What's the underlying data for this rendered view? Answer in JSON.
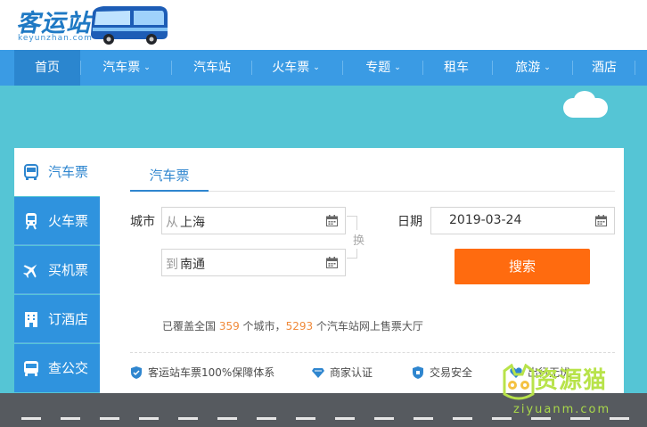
{
  "header": {
    "logo_text": "客运站",
    "logo_sub": "keyunzhan.com"
  },
  "nav": {
    "items": [
      {
        "label": "首页",
        "dropdown": false
      },
      {
        "label": "汽车票",
        "dropdown": true
      },
      {
        "label": "汽车站",
        "dropdown": false
      },
      {
        "label": "火车票",
        "dropdown": true
      },
      {
        "label": "专题",
        "dropdown": true
      },
      {
        "label": "租车",
        "dropdown": false
      },
      {
        "label": "旅游",
        "dropdown": true
      },
      {
        "label": "酒店",
        "dropdown": false
      }
    ]
  },
  "sidebar": {
    "items": [
      {
        "label": "汽车票",
        "icon": "bus-icon"
      },
      {
        "label": "火车票",
        "icon": "train-icon"
      },
      {
        "label": "买机票",
        "icon": "plane-icon"
      },
      {
        "label": "订酒店",
        "icon": "hotel-icon"
      },
      {
        "label": "查公交",
        "icon": "city-bus-icon"
      }
    ]
  },
  "panel": {
    "tab": "汽车票",
    "city_label": "城市",
    "from_prefix": "从",
    "from_value": "上海",
    "to_prefix": "到",
    "to_value": "南通",
    "swap_label": "换",
    "date_label": "日期",
    "date_value": "2019-03-24",
    "search_label": "搜索",
    "coverage": {
      "part1": "已覆盖全国 ",
      "cities": "359",
      "part2": " 个城市，",
      "stations": "5293",
      "part3": " 个汽车站网上售票大厅"
    },
    "features": [
      "客运站车票100%保障体系",
      "商家认证",
      "交易安全",
      "出行无忧"
    ]
  },
  "watermark": {
    "text": "资源猫",
    "url": "ziyuanm.com"
  },
  "colors": {
    "nav": "#3a9be4",
    "hero": "#55c5d5",
    "sidebar": "#2f93de",
    "search": "#ff6b0f",
    "accent": "#f08a3a"
  }
}
